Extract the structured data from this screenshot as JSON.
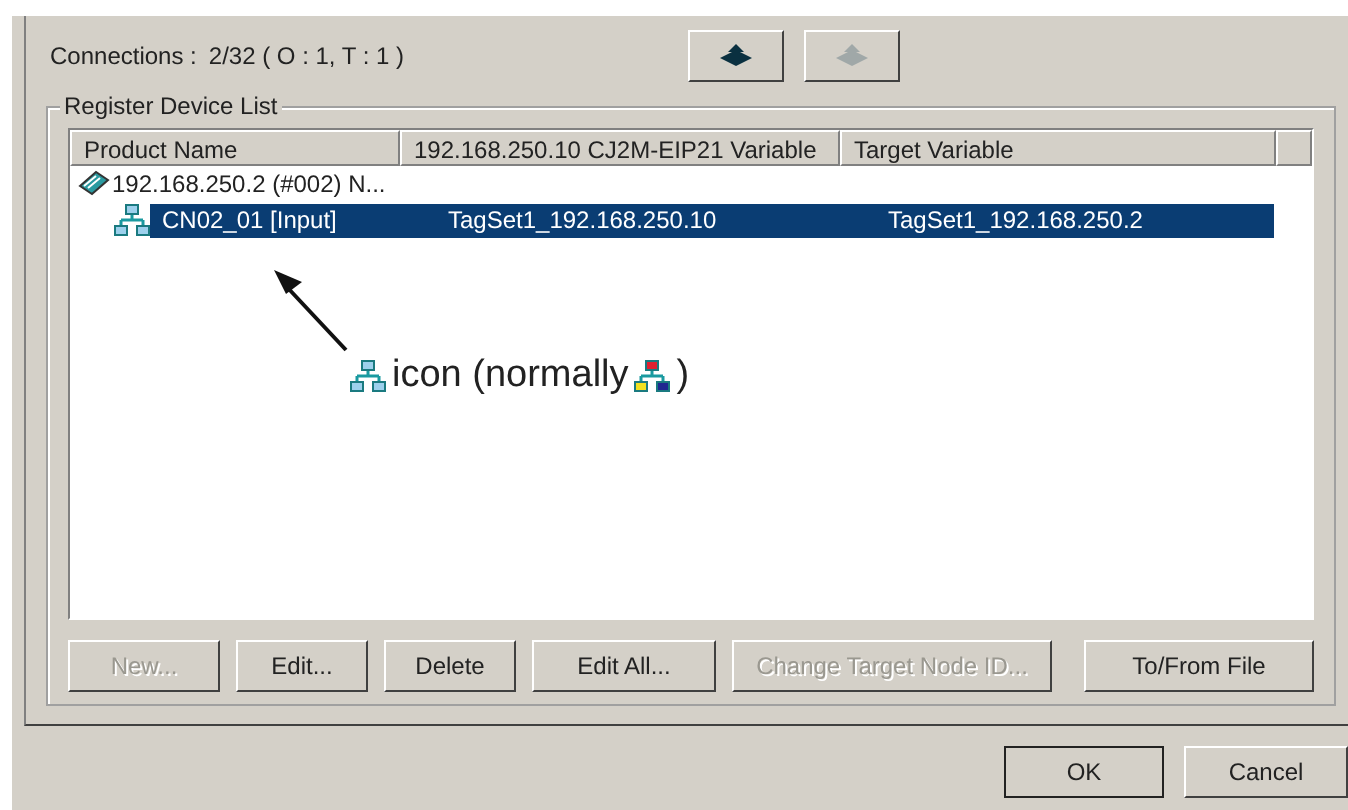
{
  "connections": {
    "label": "Connections :",
    "value": "2/32 ( O : 1, T : 1 )"
  },
  "group": {
    "title": "Register Device List"
  },
  "table": {
    "columns": [
      "Product Name",
      "192.168.250.10 CJ2M-EIP21 Variable",
      "Target Variable"
    ],
    "rows": [
      {
        "name": "192.168.250.2 (#002) N...",
        "selected": false,
        "children": [
          {
            "name": "CN02_01 [Input]",
            "cells": [
              "TagSet1_192.168.250.10",
              "TagSet1_192.168.250.2"
            ],
            "selected": true
          }
        ]
      }
    ]
  },
  "annotation": {
    "text_before": "icon (normally",
    "text_after": ")"
  },
  "buttons": [
    {
      "label": "New...",
      "disabled": true
    },
    {
      "label": "Edit...",
      "disabled": false
    },
    {
      "label": "Delete",
      "disabled": false
    },
    {
      "label": "Edit All...",
      "disabled": false
    },
    {
      "label": "Change Target Node ID...",
      "disabled": true
    },
    {
      "label": "To/From File",
      "disabled": false
    }
  ],
  "dialog_buttons": [
    "OK",
    "Cancel"
  ]
}
